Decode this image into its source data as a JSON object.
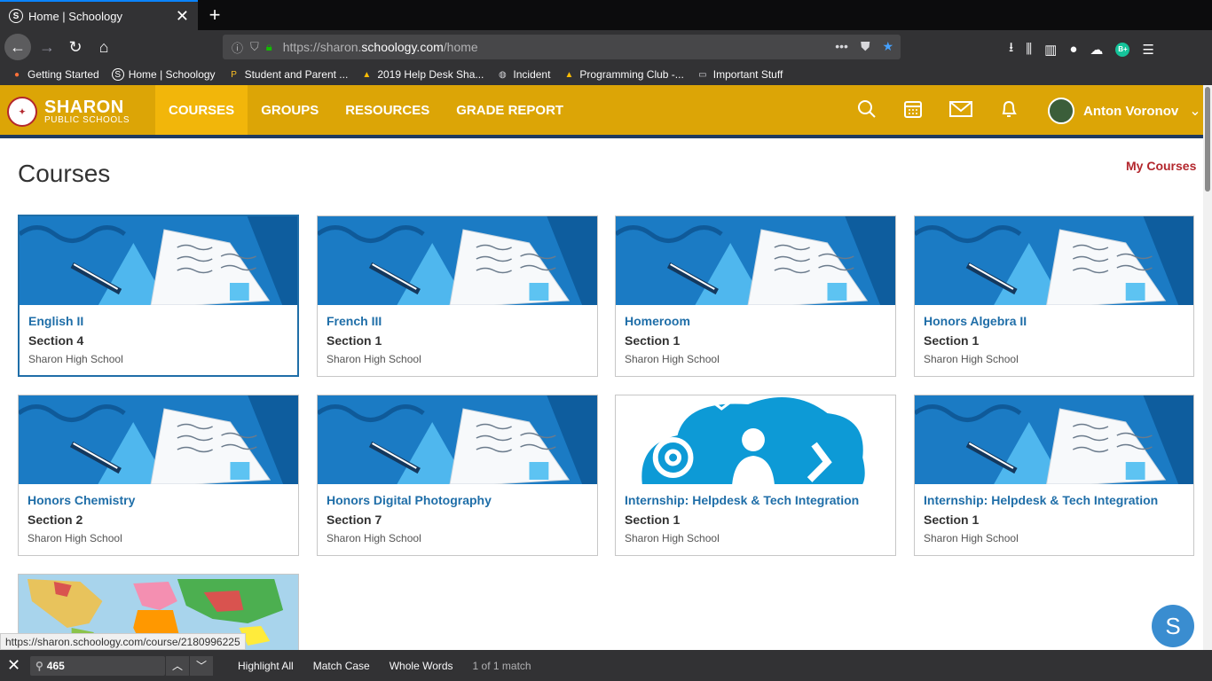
{
  "browser": {
    "tab_title": "Home | Schoology",
    "tab_favicon_letter": "S",
    "url_prefix": "https://sharon.",
    "url_domain": "schoology.com",
    "url_path": "/home",
    "grammarly_badge": "B+",
    "bookmarks": [
      {
        "label": "Getting Started",
        "icon": "firefox-icon"
      },
      {
        "label": "Home | Schoology",
        "icon": "schoology-icon"
      },
      {
        "label": "Student and Parent ...",
        "icon": "p-icon"
      },
      {
        "label": "2019 Help Desk Sha...",
        "icon": "drive-icon"
      },
      {
        "label": "Incident",
        "icon": "globe-icon"
      },
      {
        "label": "Programming Club -...",
        "icon": "drive-icon"
      },
      {
        "label": "Important Stuff",
        "icon": "folder-icon"
      }
    ]
  },
  "header": {
    "logo_line1": "SHARON",
    "logo_line2": "PUBLIC SCHOOLS",
    "nav": [
      "COURSES",
      "GROUPS",
      "RESOURCES",
      "GRADE REPORT"
    ],
    "active_nav": "COURSES",
    "user_name": "Anton Voronov",
    "colors": {
      "bar": "#dca506",
      "active": "#f2b60a",
      "underline": "#1e3a5f"
    }
  },
  "page": {
    "title": "Courses",
    "my_courses_link": "My Courses"
  },
  "courses": [
    {
      "name": "English II",
      "section": "Section 4",
      "school": "Sharon High School",
      "image": "book-pencil"
    },
    {
      "name": "French III",
      "section": "Section 1",
      "school": "Sharon High School",
      "image": "book-pencil"
    },
    {
      "name": "Homeroom",
      "section": "Section 1",
      "school": "Sharon High School",
      "image": "book-pencil"
    },
    {
      "name": "Honors Algebra II",
      "section": "Section 1",
      "school": "Sharon High School",
      "image": "book-pencil"
    },
    {
      "name": "Honors Chemistry",
      "section": "Section 2",
      "school": "Sharon High School",
      "image": "book-pencil"
    },
    {
      "name": "Honors Digital Photography",
      "section": "Section 7",
      "school": "Sharon High School",
      "image": "book-pencil"
    },
    {
      "name": "Internship: Helpdesk & Tech Integration",
      "section": "Section 1",
      "school": "Sharon High School",
      "image": "cloud-contact"
    },
    {
      "name": "Internship: Helpdesk & Tech Integration",
      "section": "Section 1",
      "school": "Sharon High School",
      "image": "book-pencil"
    },
    {
      "name": "",
      "section": "",
      "school": "",
      "image": "world-map"
    }
  ],
  "status_url": "https://sharon.schoology.com/course/2180996225",
  "chat_letter": "S",
  "findbar": {
    "query": "465",
    "highlight_all": "Highlight All",
    "match_case": "Match Case",
    "whole_words": "Whole Words",
    "result": "1 of 1 match"
  }
}
